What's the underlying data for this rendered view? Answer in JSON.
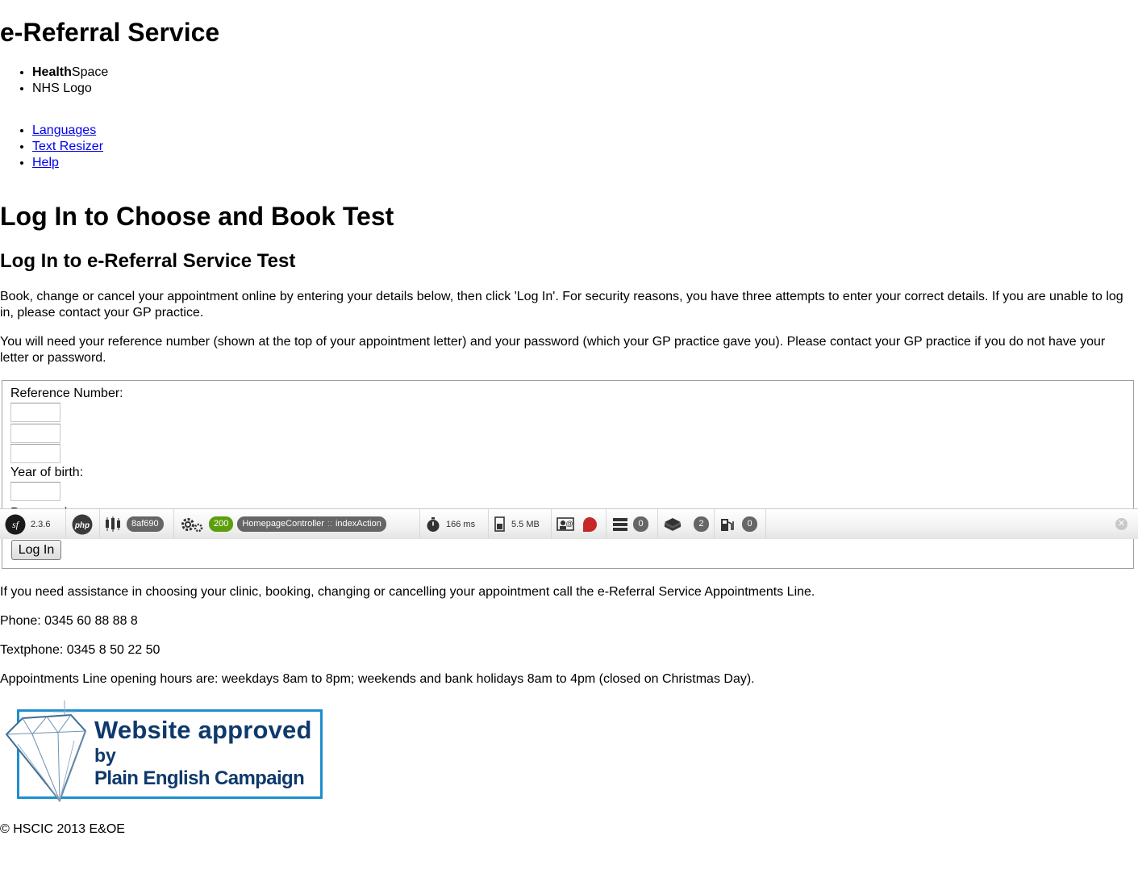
{
  "site_title": "e-Referral Service",
  "brand_list": [
    {
      "bold": "Health",
      "rest": "Space"
    },
    {
      "text": "NHS Logo"
    }
  ],
  "utility_links": [
    "Languages",
    "Text Resizer",
    "Help"
  ],
  "page_heading": "Log In to Choose and Book Test",
  "sub_heading": "Log In to e-Referral Service Test",
  "intro_paragraph_1": "Book, change or cancel your appointment online by entering your details below, then click 'Log In'. For security reasons, you have three attempts to enter your correct details. If you are unable to log in, please contact your GP practice.",
  "intro_paragraph_2": "You will need your reference number (shown at the top of your appointment letter) and your password (which your GP practice gave you). Please contact your GP practice if you do not have your letter or password.",
  "form": {
    "reference_label": "Reference Number:",
    "year_label": "Year of birth:",
    "password_label": "Password:",
    "reference_values": [
      "",
      "",
      ""
    ],
    "year_value": "",
    "login_button": "Log In"
  },
  "toolbar": {
    "symfony_version": "2.3.6",
    "php_label": "php",
    "token": "8af690",
    "status_code": "200",
    "controller": "HomepageController",
    "controller_sep": "::",
    "action": "indexAction",
    "time": "166 ms",
    "memory": "5.5 MB",
    "db_queries": "0",
    "twig_count": "2",
    "swiftmailer_count": "0"
  },
  "assistance_text": "If you need assistance in choosing your clinic, booking, changing or cancelling your appointment call the e-Referral Service Appointments Line.",
  "phone": "Phone: 0345 60 88 88 8",
  "textphone": "Textphone: 0345 8 50 22 50",
  "opening_hours": "Appointments Line opening hours are: weekdays 8am to 8pm; weekends and bank holidays 8am to 4pm (closed on Christmas Day).",
  "badge": {
    "line1": "Website approved",
    "line2": "by",
    "line3": "Plain English Campaign",
    "border_color": "#1d8fcf",
    "text_color": "#0e3a6b"
  },
  "footer": "© HSCIC 2013 E&OE"
}
